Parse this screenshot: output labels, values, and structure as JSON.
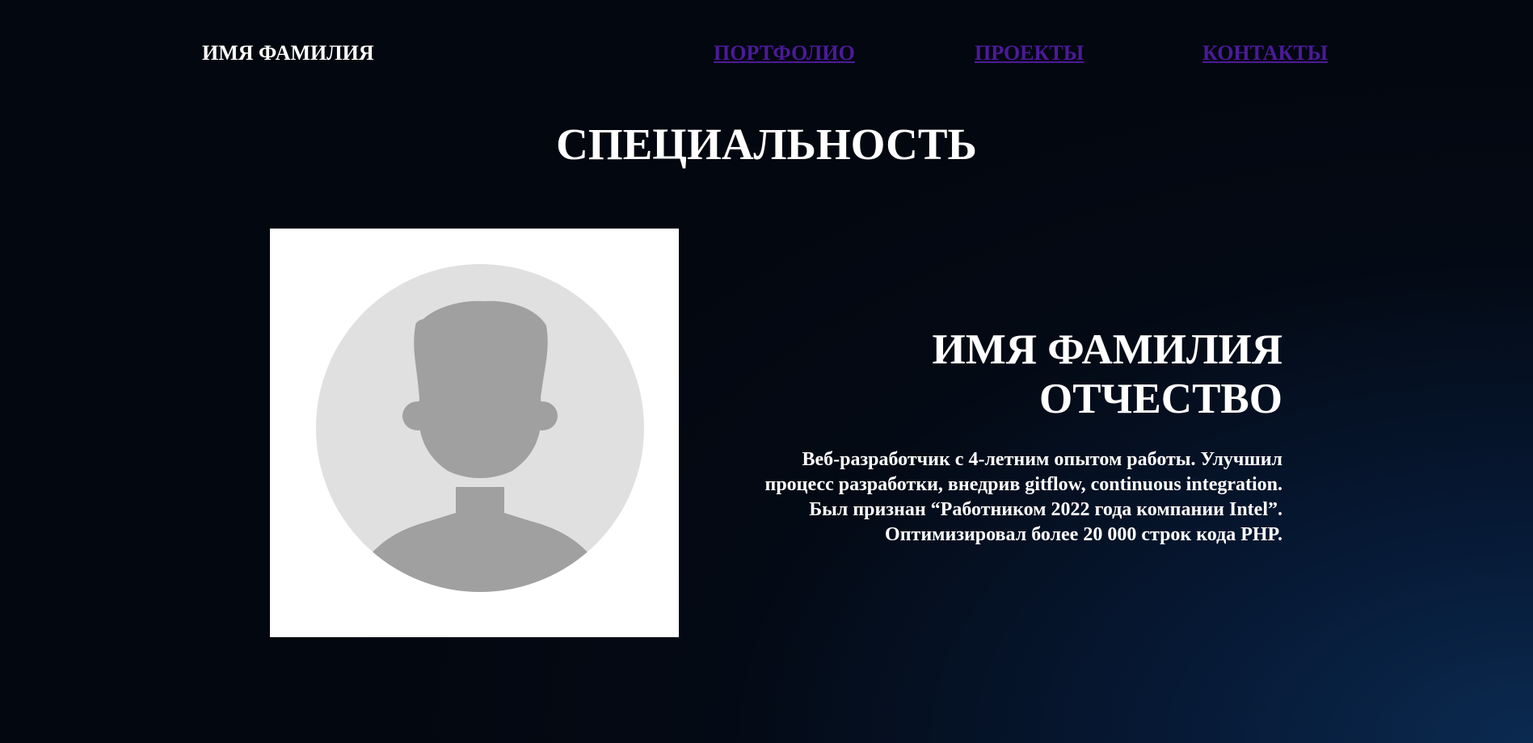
{
  "header": {
    "logo": "ИМЯ ФАМИЛИЯ",
    "nav": {
      "portfolio": "ПОРТФОЛИО",
      "projects": "ПРОЕКТЫ",
      "contacts": "КОНТАКТЫ"
    },
    "link_color": "#4b1a9a"
  },
  "main": {
    "title": "СПЕЦИАЛЬНОСТЬ",
    "profile": {
      "name_line1": "ИМЯ ФАМИЛИЯ",
      "name_line2": "ОТЧЕСТВО",
      "description": [
        "Веб-разработчик с 4-летним опытом работы. Улучшил",
        "процесс разработки, внедрив gitflow, continuous integration.",
        "Был признан “Работником 2022 года компании Intel”.",
        "Оптимизировал более 20 000 строк кода PHP."
      ],
      "avatar_icon": "user-placeholder-icon"
    }
  },
  "colors": {
    "text": "#ffffff",
    "background_dark": "#03070f",
    "background_glow": "#0b2a50",
    "avatar_circle": "#e0e0e0",
    "avatar_silhouette": "#a0a0a0"
  }
}
